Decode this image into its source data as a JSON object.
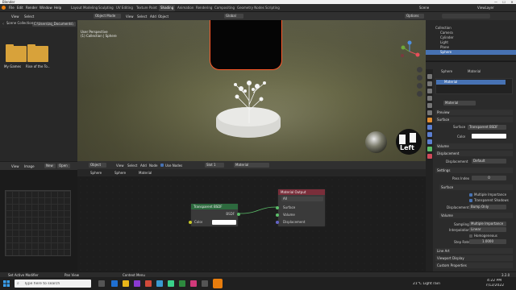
{
  "window": {
    "title": "Blender",
    "minimize": "—",
    "maximize": "☐",
    "close": "✕"
  },
  "topbar": {
    "menus": [
      "File",
      "Edit",
      "Render",
      "Window",
      "Help"
    ],
    "workspaces": [
      "Layout",
      "Modeling",
      "Sculpting",
      "UV Editing",
      "Texture Paint",
      "Shading",
      "Animation",
      "Rendering",
      "Compositing",
      "Geometry Nodes",
      "Scripting"
    ],
    "active_workspace": "Shading",
    "scene": "Scene",
    "view_layer": "ViewLayer"
  },
  "file_browser": {
    "header_menus": [
      "View",
      "Select"
    ],
    "path": "C:\\Users\\zq_Documents\\",
    "items": [
      {
        "label": "My Games"
      },
      {
        "label": "Rise of the To..."
      }
    ]
  },
  "image_editor": {
    "header_menus": [
      "View",
      "Image"
    ],
    "new_label": "New",
    "open_label": "Open"
  },
  "viewport": {
    "mode": "Object Mode",
    "menus": [
      "View",
      "Select",
      "Add",
      "Object"
    ],
    "orientation": "Global",
    "info_line1": "User Perspective",
    "info_line2": "(1) Collection | Sphere",
    "options_label": "Options",
    "left_label": "Left"
  },
  "node_editor": {
    "type": "Object",
    "menus": [
      "View",
      "Select",
      "Add",
      "Node"
    ],
    "use_nodes_label": "Use Nodes",
    "slot": "Slot 1",
    "material": "Material",
    "breadcrumb": [
      "Sphere",
      "Sphere",
      "Material"
    ],
    "node_bsdf": {
      "title": "Transparent BSDF",
      "output": "BSDF",
      "input": "Color"
    },
    "node_output": {
      "title": "Material Output",
      "target": "All",
      "sockets": [
        "Surface",
        "Volume",
        "Displacement"
      ]
    }
  },
  "outliner": {
    "title": "Scene Collection",
    "rows": [
      {
        "label": "Scene Collection",
        "selected": false
      },
      {
        "label": "Collection",
        "selected": false
      },
      {
        "label": "Camera",
        "selected": false
      },
      {
        "label": "Cylinder",
        "selected": false
      },
      {
        "label": "Light",
        "selected": false
      },
      {
        "label": "Plane",
        "selected": false
      },
      {
        "label": "Sphere",
        "selected": true
      }
    ]
  },
  "properties": {
    "object_name": "Sphere",
    "material_tab": "Material",
    "material_slot": "Material",
    "material_field": "Material",
    "sections": {
      "preview": "Preview",
      "surface": "Surface",
      "surface_field_label": "Surface",
      "surface_value": "Transparent BSDF",
      "color_label": "Color",
      "volume": "Volume",
      "displacement": "Displacement",
      "displacement_label": "Displacement",
      "displacement_value": "Default",
      "settings": "Settings",
      "pass_index_label": "Pass Index",
      "pass_index_value": "0",
      "surface_sub": "Surface",
      "multiple_importance": "Multiple Importance",
      "transparent_shadows": "Transparent Shadows",
      "disp_method_label": "Displacement",
      "disp_method_value": "Bump Only",
      "volume_sub": "Volume",
      "sampling_label": "Sampling",
      "sampling_value": "Multiple Importance",
      "interpolation_label": "Interpolation",
      "interpolation_value": "Linear",
      "homogeneous": "Homogeneous",
      "step_rate_label": "Step Rate",
      "step_rate_value": "1.0000",
      "line_art": "Line Art",
      "viewport_display": "Viewport Display",
      "custom_properties": "Custom Properties"
    }
  },
  "statusbar": {
    "left": "Set Active Modifier",
    "mid1": "Pan View",
    "mid2": "Context Menu",
    "version": "3.2.0"
  },
  "taskbar": {
    "search_placeholder": "Type here to search",
    "weather": "21°C  Light rain",
    "time": "4:22 PM",
    "date": "7/12/2022"
  }
}
